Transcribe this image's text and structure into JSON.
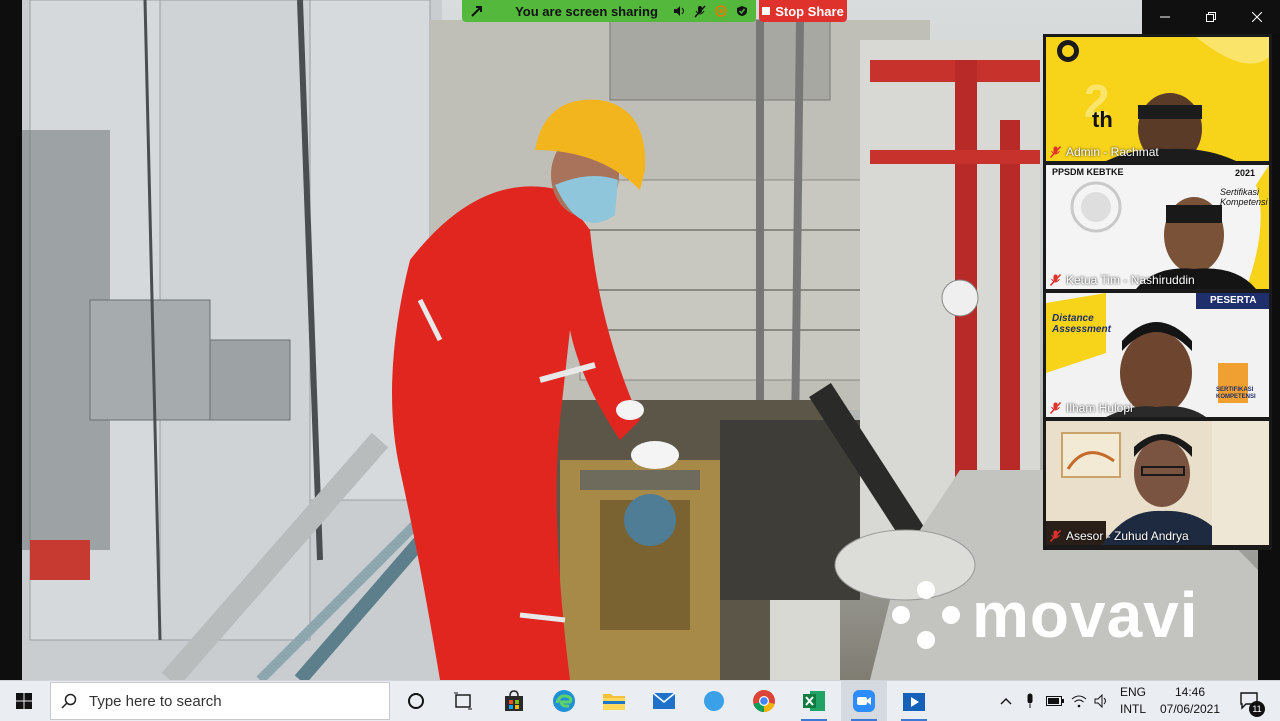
{
  "share_bar": {
    "status_text": "You are screen sharing",
    "stop_label": "Stop Share"
  },
  "participants": [
    {
      "name": "Admin - Rachmat",
      "muted": true
    },
    {
      "name": "Ketua Tim - Nashiruddin",
      "muted": true
    },
    {
      "name": "Ilham Hulopi",
      "muted": true
    },
    {
      "name": "Asesor - Zuhud Andrya",
      "muted": true
    }
  ],
  "tile_text": {
    "anniversary": "th",
    "org_badge": "PPSDM KEBTKE",
    "year": "2021",
    "cert_script": "Sertifikasi Kompetensi",
    "peserta": "PESERTA",
    "distance": "Distance Assessment",
    "sertifikasi": "SERTIFIKASI KOMPETENSI"
  },
  "watermark": {
    "text": "movavi"
  },
  "taskbar": {
    "search_placeholder": "Type here to search",
    "lang_top": "ENG",
    "lang_bottom": "INTL",
    "time": "14:46",
    "date": "07/06/2021",
    "notification_count": "11"
  },
  "colors": {
    "share_green": "#54b83c",
    "stop_red": "#e0322d",
    "taskbar_bg": "#eaeef3",
    "zoom_blue": "#2d8cff"
  }
}
